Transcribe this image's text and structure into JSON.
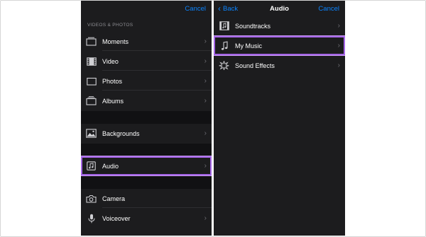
{
  "left_panel": {
    "cancel_label": "Cancel",
    "section_header": "VIDEOS & PHOTOS",
    "items": [
      {
        "label": "Moments",
        "icon": "moments-icon"
      },
      {
        "label": "Video",
        "icon": "film-icon"
      },
      {
        "label": "Photos",
        "icon": "photo-icon"
      },
      {
        "label": "Albums",
        "icon": "albums-icon"
      },
      {
        "label": "Backgrounds",
        "icon": "backgrounds-icon"
      },
      {
        "label": "Audio",
        "icon": "music-note-icon",
        "highlighted": true
      },
      {
        "label": "Camera",
        "icon": "camera-icon"
      },
      {
        "label": "Voiceover",
        "icon": "microphone-icon"
      }
    ]
  },
  "right_panel": {
    "back_label": "Back",
    "title": "Audio",
    "cancel_label": "Cancel",
    "items": [
      {
        "label": "Soundtracks",
        "icon": "soundtracks-icon"
      },
      {
        "label": "My Music",
        "icon": "music-note-icon",
        "highlighted": true
      },
      {
        "label": "Sound Effects",
        "icon": "sound-effects-icon"
      }
    ]
  },
  "colors": {
    "panel_background": "#1c1c1e",
    "accent": "#0a84ff",
    "highlight": "#a565e6",
    "text": "#ffffff",
    "secondary_text": "#8e8e93"
  }
}
